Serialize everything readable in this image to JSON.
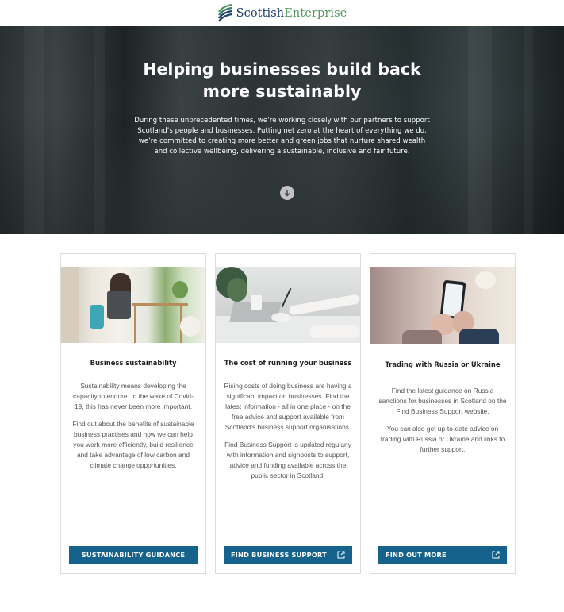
{
  "header": {
    "logo_word1": "Scottish",
    "logo_word2": "Enterprise",
    "logo_icon": "scottish-enterprise-logo-mark"
  },
  "hero": {
    "title": "Helping businesses build back more sustainably",
    "text": "During these unprecedented times, we’re working closely with our partners to support Scotland’s people and businesses. Putting net zero at the heart of everything we do, we’re committed to creating more better and green jobs that nurture shared wealth and collective wellbeing, delivering a sustainable, inclusive and fair future.",
    "scroll_icon": "arrow-down-circle-icon"
  },
  "cards": [
    {
      "title": "Business sustainability",
      "paragraphs": [
        "Sustainability means developing the capacity to endure. In the wake of Covid-19, this has never been more important.",
        "Find out about the benefits of sustainable business practises and how we can help you work more efficiently, build resilience and take advantage of low carbon and climate change opportunities."
      ],
      "button": "SUSTAINABILITY GUIDANCE",
      "external": false
    },
    {
      "title": "The cost of running your business",
      "paragraphs": [
        "Rising costs of doing business are having a significant impact on businesses. Find the latest information - all in one place - on the free advice and support available from Scotland's business support organisations.",
        "Find Business Support is updated regularly with information and signposts to support, advice and funding available across the public sector in Scotland."
      ],
      "button": "FIND BUSINESS SUPPORT",
      "external": true
    },
    {
      "title": "Trading with Russia or Ukraine",
      "paragraphs": [
        "Find the latest guidance on Russia sanctions for businesses in Scotland on the Find Business Support website.",
        "You can also get up-to-date advice on trading with Russia or Ukraine and links to further support."
      ],
      "button": "FIND OUT MORE",
      "external": true
    }
  ],
  "colors": {
    "button_bg": "#15628c",
    "logo_blue": "#1d3c6e",
    "logo_green": "#4f9a5e"
  }
}
